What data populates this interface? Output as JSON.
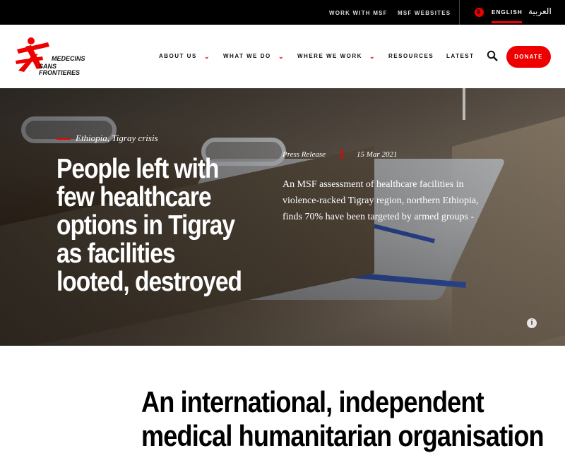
{
  "topbar": {
    "work_with": "WORK WITH MSF",
    "websites": "MSF WEBSITES",
    "lang_current": "ENGLISH",
    "lang_alt": "العربية"
  },
  "logo": {
    "line1": "MEDECINS",
    "line2": "SANS FRONTIERES",
    "color": "#ee0000"
  },
  "nav": {
    "items": [
      "ABOUT US",
      "WHAT WE DO",
      "WHERE WE WORK",
      "RESOURCES",
      "LATEST"
    ],
    "donate": "DONATE"
  },
  "hero": {
    "tag": "Ethiopia, Tigray crisis",
    "title": "People left with few healthcare options in Tigray as facilities looted, destroyed",
    "type": "Press Release",
    "date": "15 Mar 2021",
    "summary": "An MSF assessment of healthcare facilities in violence-racked Tigray region, northern Ethiopia, finds 70% have been targeted by armed groups -",
    "info": "i"
  },
  "intro": {
    "line1": "An international, independent",
    "line2": "medical humanitarian organisation"
  },
  "colors": {
    "accent": "#ee0000",
    "topbar": "#000000"
  },
  "icons": [
    "globe-icon",
    "chevron-down-icon",
    "search-icon",
    "info-icon"
  ]
}
